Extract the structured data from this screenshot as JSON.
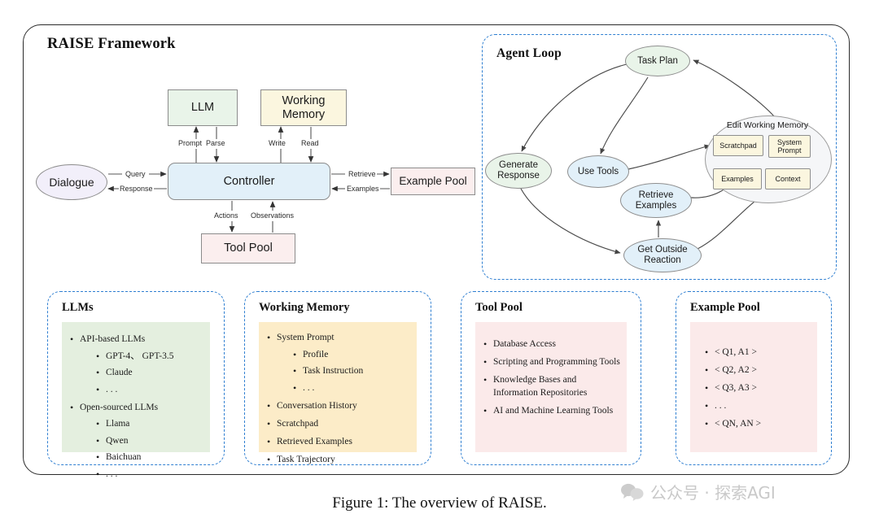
{
  "figure": {
    "caption": "Figure 1: The overview of RAISE.",
    "watermark": "公众号 · 探索AGI",
    "watermark_icon": "wechat-icon"
  },
  "framework": {
    "title": "RAISE Framework",
    "nodes": {
      "llm": "LLM",
      "working_memory": "Working Memory",
      "controller": "Controller",
      "dialogue": "Dialogue",
      "example_pool": "Example Pool",
      "tool_pool": "Tool Pool"
    },
    "edges": {
      "prompt": "Prompt",
      "parse": "Parse",
      "write": "Write",
      "read": "Read",
      "query": "Query",
      "response": "Response",
      "retrieve": "Retrieve",
      "examples": "Examples",
      "actions": "Actions",
      "observations": "Observations"
    },
    "colors": {
      "llm": "#e9f4e9",
      "working_memory": "#fbf6df",
      "controller": "#e2f0f9",
      "dialogue": "#f2effa",
      "example_pool": "#fbeeee",
      "tool_pool": "#fbeeee",
      "stroke": "#8c8c8c",
      "frame": "#2b2b2b"
    }
  },
  "agent_loop": {
    "title": "Agent Loop",
    "nodes": {
      "task_plan": "Task Plan",
      "generate_response": "Generate Response",
      "use_tools": "Use Tools",
      "retrieve_examples": "Retrieve Examples",
      "get_outside_reaction": "Get Outside Reaction",
      "edit_working_memory": "Edit Working Memory",
      "scratchpad": "Scratchpad",
      "system_prompt": "System Prompt",
      "examples": "Examples",
      "context": "Context"
    },
    "colors": {
      "green_node": "#e9f4e9",
      "blue_node": "#ddeefa",
      "memory_item": "#fbf6df",
      "memory_group": "#f5f6f8",
      "panel_border": "#2f7fd1"
    }
  },
  "panels": [
    {
      "key": "llms",
      "title": "LLMs",
      "fill": "#e4efdf",
      "items": [
        {
          "text": "API-based LLMs",
          "sub": [
            "GPT-4、 GPT-3.5",
            "Claude",
            ". . ."
          ]
        },
        {
          "text": "Open-sourced LLMs",
          "sub": [
            "Llama",
            "Qwen",
            "Baichuan",
            ". . ."
          ]
        }
      ]
    },
    {
      "key": "working_memory",
      "title": "Working Memory",
      "fill": "#fcecc8",
      "items": [
        {
          "text": "System Prompt",
          "sub": [
            "Profile",
            "Task Instruction",
            ". . ."
          ]
        },
        {
          "text": "Conversation History",
          "sub": []
        },
        {
          "text": "Scratchpad",
          "sub": []
        },
        {
          "text": "Retrieved Examples",
          "sub": []
        },
        {
          "text": "Task  Trajectory",
          "sub": []
        }
      ]
    },
    {
      "key": "tool_pool",
      "title": "Tool  Pool",
      "fill": "#fbeaea",
      "items": [
        {
          "text": "Database Access",
          "sub": []
        },
        {
          "text": "Scripting and Programming Tools",
          "sub": []
        },
        {
          "text": "Knowledge Bases and Information Repositories",
          "sub": []
        },
        {
          "text": "AI and Machine Learning Tools",
          "sub": []
        }
      ]
    },
    {
      "key": "example_pool",
      "title": "Example  Pool",
      "fill": "#fbeaea",
      "items": [
        {
          "text": "< Q1,  A1 >",
          "sub": []
        },
        {
          "text": "< Q2,  A2 >",
          "sub": []
        },
        {
          "text": "< Q3,  A3 >",
          "sub": []
        },
        {
          "text": ". . .",
          "sub": []
        },
        {
          "text": "< QN,  AN >",
          "sub": []
        }
      ]
    }
  ]
}
